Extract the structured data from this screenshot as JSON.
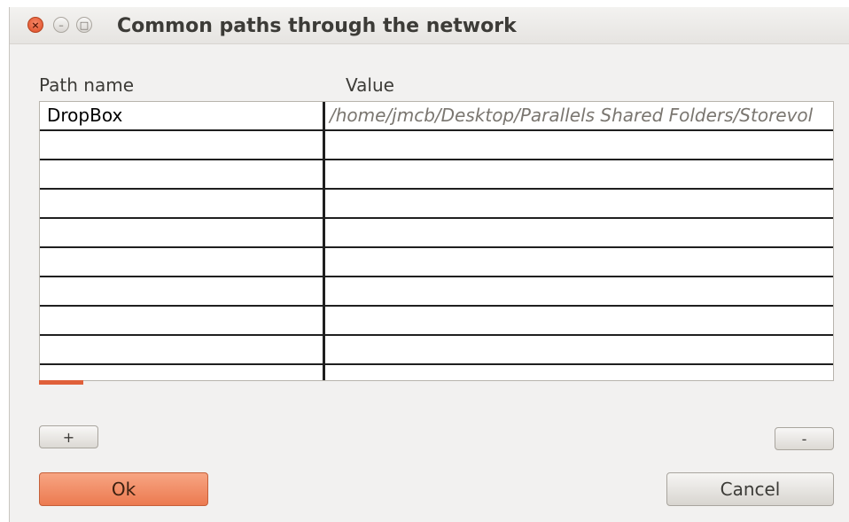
{
  "window": {
    "title": "Common paths through the network",
    "controls": {
      "close": "×",
      "minimize": "–",
      "maximize": "□"
    }
  },
  "table": {
    "headers": {
      "name": "Path name",
      "value": "Value"
    },
    "rows": [
      {
        "name": "DropBox",
        "value": "/home/jmcb/Desktop/Parallels Shared Folders/Storevol"
      },
      {
        "name": "",
        "value": ""
      },
      {
        "name": "",
        "value": ""
      },
      {
        "name": "",
        "value": ""
      },
      {
        "name": "",
        "value": ""
      },
      {
        "name": "",
        "value": ""
      },
      {
        "name": "",
        "value": ""
      },
      {
        "name": "",
        "value": ""
      },
      {
        "name": "",
        "value": ""
      },
      {
        "name": "",
        "value": ""
      }
    ]
  },
  "buttons": {
    "add": "+",
    "remove": "-",
    "ok": "Ok",
    "cancel": "Cancel"
  },
  "colors": {
    "accent": "#ec7a50",
    "close_button": "#dd4a22",
    "window_bg": "#f2f1f0"
  }
}
